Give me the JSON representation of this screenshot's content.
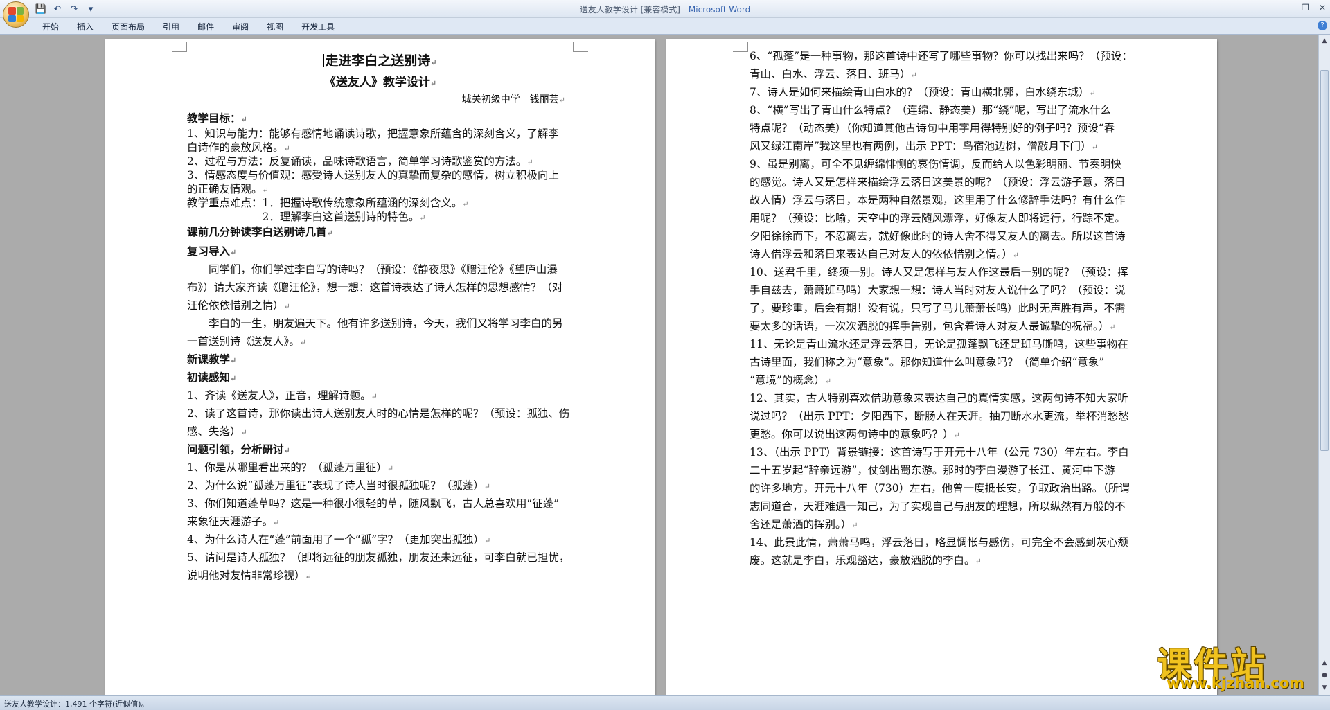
{
  "window": {
    "title": "送友人教学设计 [兼容模式] - ",
    "app_name": "Microsoft Word",
    "controls": [
      "‒",
      "❐",
      "✕"
    ]
  },
  "qat": {
    "save": "💾",
    "undo": "↶",
    "redo": "↷",
    "more": "▾"
  },
  "ribbon": {
    "tabs": [
      "开始",
      "插入",
      "页面布局",
      "引用",
      "邮件",
      "审阅",
      "视图",
      "开发工具"
    ],
    "help": "?"
  },
  "left_page": {
    "title": "走进李白之送别诗",
    "subtitle": "《送友人》教学设计",
    "author": "城关初级中学　钱丽芸",
    "lines": [
      "教学目标：",
      "1、知识与能力：能够有感情地诵读诗歌，把握意象所蕴含的深刻含义，了解李",
      "白诗作的豪放风格。",
      "2、过程与方法：反复诵读，品味诗歌语言，简单学习诗歌鉴赏的方法。",
      "3、情感态度与价值观：感受诗人送别友人的真挚而复杂的感情，树立积极向上",
      "的正确友情观。",
      "教学重点难点：1．把握诗歌传统意象所蕴涵的深刻含义。",
      "　　　　　　　2．理解李白这首送别诗的特色。",
      "课前几分钟读李白送别诗几首",
      "复习导入",
      "　　同学们，你们学过李白写的诗吗？（预设：《静夜思》《赠汪伦》《望庐山瀑",
      "布》）请大家齐读《赠汪伦》，想一想：这首诗表达了诗人怎样的思想感情？（对",
      "汪伦依依惜别之情）",
      "　　李白的一生，朋友遍天下。他有许多送别诗，今天，我们又将学习李白的另",
      "一首送别诗《送友人》。",
      "新课教学",
      "初读感知",
      "1、齐读《送友人》，正音，理解诗题。",
      "2、读了这首诗，那你读出诗人送别友人时的心情是怎样的呢？（预设：孤独、伤",
      "感、失落）",
      "问题引领，分析研讨",
      "1、你是从哪里看出来的？（孤蓬万里征）",
      "2、为什么说“孤蓬万里征”表现了诗人当时很孤独呢？（孤蓬）",
      "3、你们知道蓬草吗？这是一种很小很轻的草，随风飘飞，古人总喜欢用“征蓬”",
      "来象征天涯游子。",
      "4、为什么诗人在“蓬”前面用了一个“孤”字？（更加突出孤独）",
      "5、请问是诗人孤独？（即将远征的朋友孤独，朋友还未远征，可李白就已担忧，",
      "说明他对友情非常珍视）"
    ]
  },
  "right_page": {
    "lines": [
      "6、“孤蓬”是一种事物，那这首诗中还写了哪些事物？你可以找出来吗？（预设：",
      "青山、白水、浮云、落日、班马）",
      "7、诗人是如何来描绘青山白水的？（预设：青山横北郭，白水绕东城）",
      "8、“横”写出了青山什么特点？（连绵、静态美）那“绕”呢，写出了流水什么",
      "特点呢？（动态美）（你知道其他古诗句中用字用得特别好的例子吗？预设“春",
      "风又绿江南岸”我这里也有两例，出示 PPT：鸟宿池边树，僧敲月下门）",
      "9、虽是别离，可全不见缠绵悱恻的哀伤情调，反而给人以色彩明丽、节奏明快",
      "的感觉。诗人又是怎样来描绘浮云落日这美景的呢？（预设：浮云游子意，落日",
      "故人情）浮云与落日，本是两种自然景观，这里用了什么修辞手法吗？有什么作",
      "用呢？（预设：比喻，天空中的浮云随风漂浮，好像友人即将远行，行踪不定。",
      "夕阳徐徐而下，不忍离去，就好像此时的诗人舍不得又友人的离去。所以这首诗",
      "诗人借浮云和落日来表达自己对友人的依依惜别之情。）",
      "10、送君千里，终须一别。诗人又是怎样与友人作这最后一别的呢？（预设：挥",
      "手自兹去，萧萧班马鸣）大家想一想：诗人当时对友人说什么了吗？（预设：说",
      "了，要珍重，后会有期！没有说，只写了马儿萧萧长鸣）此时无声胜有声，不需",
      "要太多的话语，一次次洒脱的挥手告别，包含着诗人对友人最诚挚的祝福。）",
      "11、无论是青山流水还是浮云落日，无论是孤蓬飘飞还是班马嘶鸣，这些事物在",
      "古诗里面，我们称之为“意象”。那你知道什么叫意象吗？（简单介绍“意象”",
      "“意境”的概念）",
      "12、其实，古人特别喜欢借助意象来表达自己的真情实感，这两句诗不知大家听",
      "说过吗？（出示 PPT：夕阳西下，断肠人在天涯。抽刀断水水更流，举杯消愁愁",
      "更愁。你可以说出这两句诗中的意象吗？）",
      "13、（出示 PPT）背景链接：这首诗写于开元十八年（公元 730）年左右。李白",
      "二十五岁起“辞亲远游”，仗剑出蜀东游。那时的李白漫游了长江、黄河中下游",
      "的许多地方，开元十八年（730）左右，他曾一度抵长安，争取政治出路。（所谓",
      "志同道合，天涯难遇一知己，为了实现自己与朋友的理想，所以纵然有万般的不",
      "舍还是萧洒的挥别。）",
      "14、此景此情，萧萧马鸣，浮云落日，略显惆怅与感伤，可完全不会感到灰心颓",
      "废。这就是李白，乐观豁达，豪放洒脱的李白。"
    ]
  },
  "status_bar": {
    "text": "送友人教学设计：1,491 个字符(近似值)。"
  },
  "watermark": {
    "big": "课件站",
    "small": "www.kjzhan.com"
  },
  "colors": {
    "word_blue": "#3a66b0",
    "page_bg": "#ffffff",
    "canvas_bg": "#ababab"
  }
}
